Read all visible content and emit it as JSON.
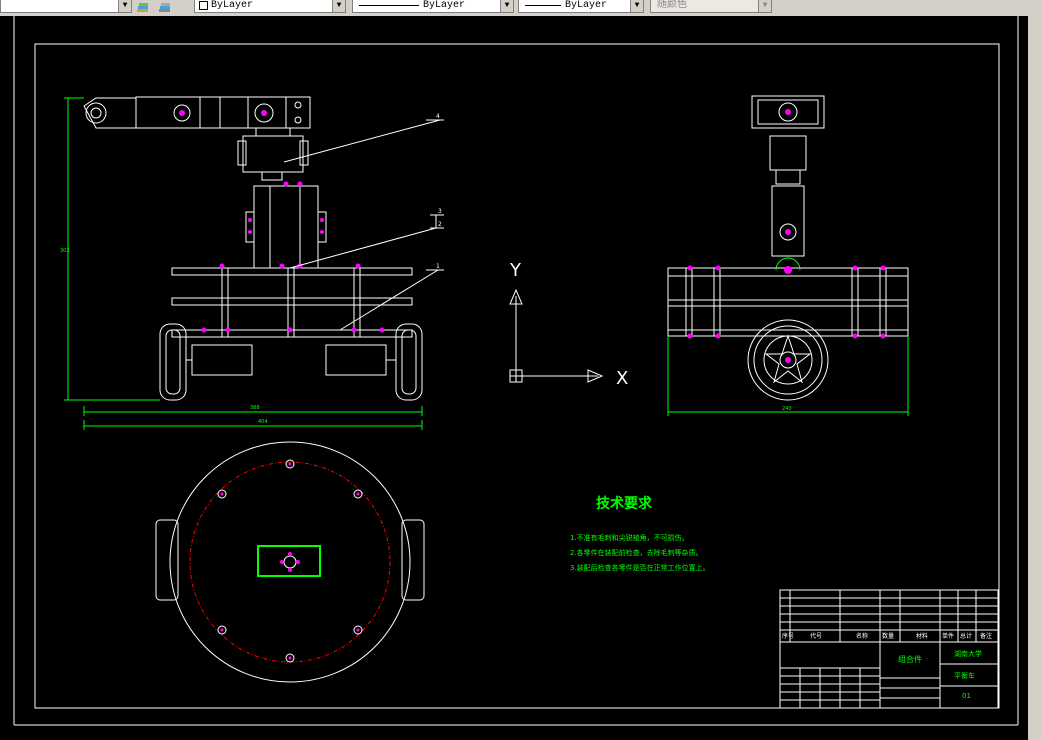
{
  "toolbar": {
    "layer_value": "ByLayer",
    "linetype_value": "ByLayer",
    "lineweight_value": "ByLayer",
    "color_value": "随颜色"
  },
  "drawing": {
    "axis_y": "Y",
    "axis_x": "X",
    "tech_title": "技术要求",
    "tech_notes": [
      "1.不准有毛刺和尖锐棱角，不可损伤。",
      "2.各零件在装配前检查，去除毛刺等杂质。",
      "3.装配后检查各零件是否在正常工作位置上。"
    ],
    "balloons": [
      "4",
      "3",
      "2",
      "1"
    ]
  },
  "title_block": {
    "header": [
      "序号",
      "代号",
      "名称",
      "数量",
      "材料",
      "单件",
      "总计",
      "备注"
    ],
    "assembly_name": "组合件",
    "school": "湖南大学",
    "drawing_name": "平衡车",
    "sheet": "01"
  },
  "colors": {
    "background": "#000000",
    "frame": "#ffffff",
    "dimension": "#00ff00",
    "hidden": "#ff0000",
    "accent": "#ff00ff"
  }
}
